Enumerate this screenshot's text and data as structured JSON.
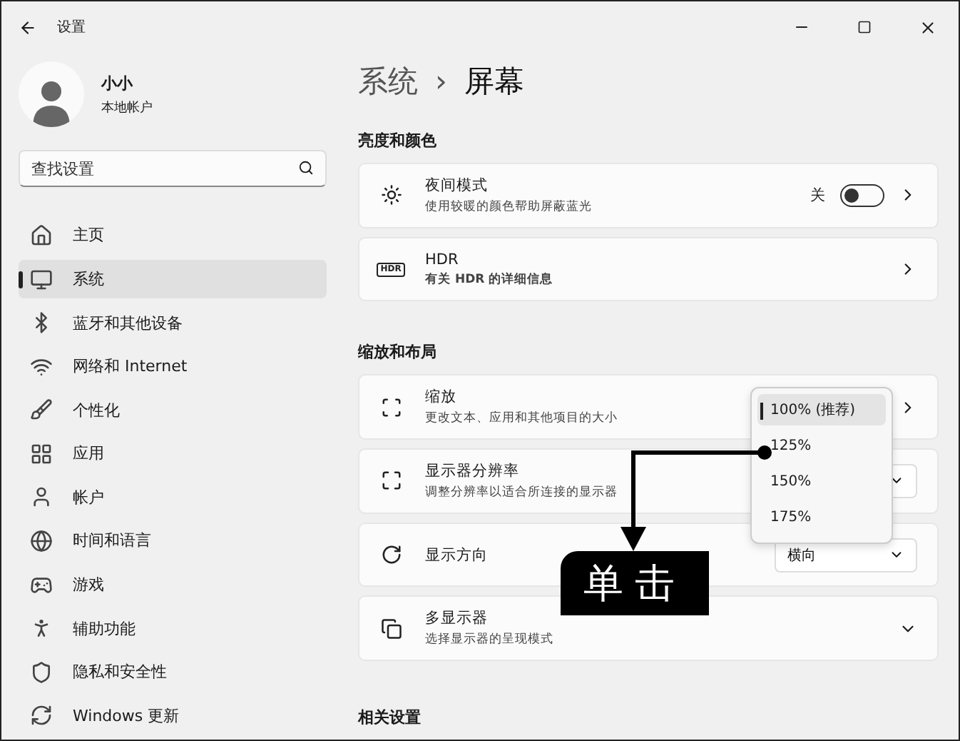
{
  "window": {
    "title": "设置"
  },
  "user": {
    "name": "小小",
    "account": "本地帐户"
  },
  "search": {
    "placeholder": "查找设置"
  },
  "sidebar": {
    "items": [
      {
        "label": "主页",
        "selected": false
      },
      {
        "label": "系统",
        "selected": true
      },
      {
        "label": "蓝牙和其他设备",
        "selected": false
      },
      {
        "label": "网络和 Internet",
        "selected": false
      },
      {
        "label": "个性化",
        "selected": false
      },
      {
        "label": "应用",
        "selected": false
      },
      {
        "label": "帐户",
        "selected": false
      },
      {
        "label": "时间和语言",
        "selected": false
      },
      {
        "label": "游戏",
        "selected": false
      },
      {
        "label": "辅助功能",
        "selected": false
      },
      {
        "label": "隐私和安全性",
        "selected": false
      },
      {
        "label": "Windows 更新",
        "selected": false
      }
    ]
  },
  "breadcrumb": {
    "parent": "系统",
    "separator": "›",
    "current": "屏幕"
  },
  "sections": [
    {
      "heading": "亮度和颜色",
      "rows": [
        {
          "kind": "toggle",
          "title": "夜间模式",
          "subtitle": "使用较暖的颜色帮助屏蔽蓝光",
          "toggle_label": "关",
          "on": false
        },
        {
          "kind": "link",
          "badge": "HDR",
          "title": "HDR",
          "subtitle": "有关 HDR 的详细信息",
          "bold_subtitle": true
        }
      ]
    },
    {
      "heading": "缩放和布局",
      "rows": [
        {
          "kind": "link",
          "title": "缩放",
          "subtitle": "更改文本、应用和其他项目的大小"
        },
        {
          "kind": "dropdown",
          "title": "显示器分辨率",
          "subtitle": "调整分辨率以适合所连接的显示器"
        },
        {
          "kind": "dropdown",
          "title": "显示方向",
          "value": "横向"
        },
        {
          "kind": "expand",
          "title": "多显示器",
          "subtitle": "选择显示器的呈现模式"
        }
      ]
    },
    {
      "heading": "相关设置"
    }
  ],
  "scale_menu": {
    "options": [
      {
        "label": "100% (推荐)",
        "selected": true
      },
      {
        "label": "125%",
        "selected": false
      },
      {
        "label": "150%",
        "selected": false
      },
      {
        "label": "175%",
        "selected": false
      }
    ]
  },
  "annotation": {
    "callout": "单击"
  }
}
